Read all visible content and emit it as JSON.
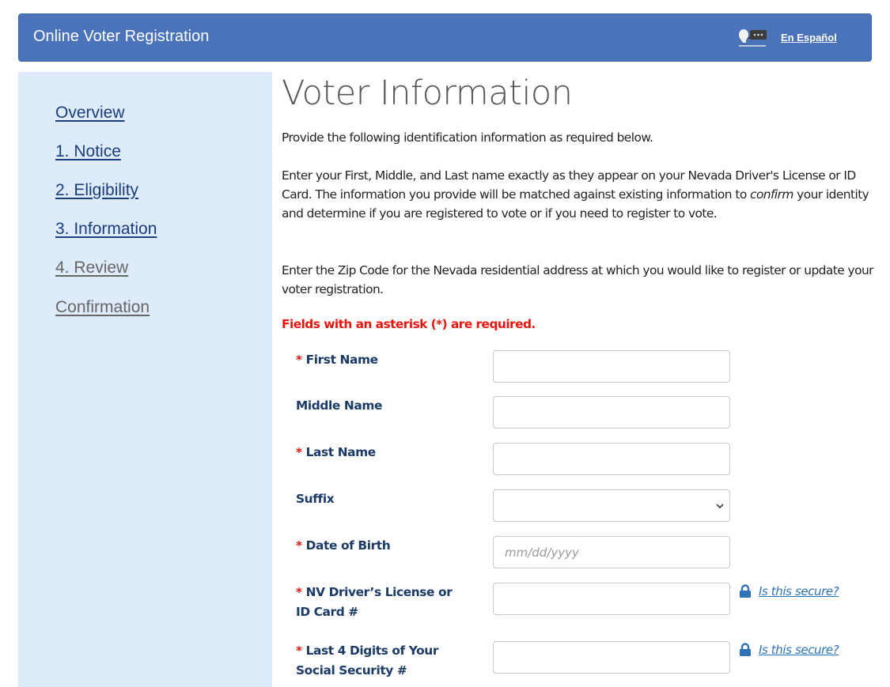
{
  "header": {
    "title": "Online Voter Registration",
    "language_icon": "speaking-person-icon",
    "language_link": "En Español"
  },
  "sidebar": {
    "items": [
      {
        "label": "Overview",
        "state": "enabled"
      },
      {
        "label": "1. Notice",
        "state": "enabled"
      },
      {
        "label": "2. Eligibility",
        "state": "enabled"
      },
      {
        "label": "3. Information",
        "state": "enabled"
      },
      {
        "label": "4. Review",
        "state": "disabled"
      },
      {
        "label": "Confirmation",
        "state": "disabled"
      }
    ]
  },
  "main": {
    "title": "Voter Information",
    "intro": "Provide the following identification information as required below.",
    "name_instructions": {
      "before": "Enter your First, Middle, and Last name exactly as they appear on your Nevada Driver's License or ID Card.  The information you provide will be matched against existing information to ",
      "emphasis": "confirm",
      "after": " your identity and determine if you are registered to vote or if you need to register to vote."
    },
    "zip_instructions": "Enter the Zip Code for the Nevada residential address at which you would like to register or update your voter registration.",
    "required_note": "Fields with an asterisk (*) are required."
  },
  "form": {
    "asterisk": "*",
    "fields": [
      {
        "label": "First Name",
        "required": true,
        "type": "text",
        "value": "",
        "placeholder": ""
      },
      {
        "label": "Middle Name",
        "required": false,
        "type": "text",
        "value": "",
        "placeholder": ""
      },
      {
        "label": "Last Name",
        "required": true,
        "type": "text",
        "value": "",
        "placeholder": ""
      },
      {
        "label": "Suffix",
        "required": false,
        "type": "select",
        "value": "",
        "placeholder": ""
      },
      {
        "label": "Date of Birth",
        "required": true,
        "type": "text",
        "value": "",
        "placeholder": "mm/dd/yyyy"
      },
      {
        "label": "NV Driver’s License or ID Card #",
        "required": true,
        "type": "text",
        "value": "",
        "placeholder": "",
        "help_link": "Is this secure?"
      },
      {
        "label": "Last 4 Digits of Your Social Security #",
        "required": true,
        "type": "text",
        "value": "",
        "placeholder": "",
        "help_link": "Is this secure?"
      }
    ]
  },
  "colors": {
    "header_bg": "#4a73b9",
    "sidebar_bg": "#deebfb",
    "nav_link": "#1a3d7c",
    "nav_disabled": "#666666",
    "label": "#1b3a66",
    "required": "#e8160f",
    "help_link": "#2f73b7"
  }
}
